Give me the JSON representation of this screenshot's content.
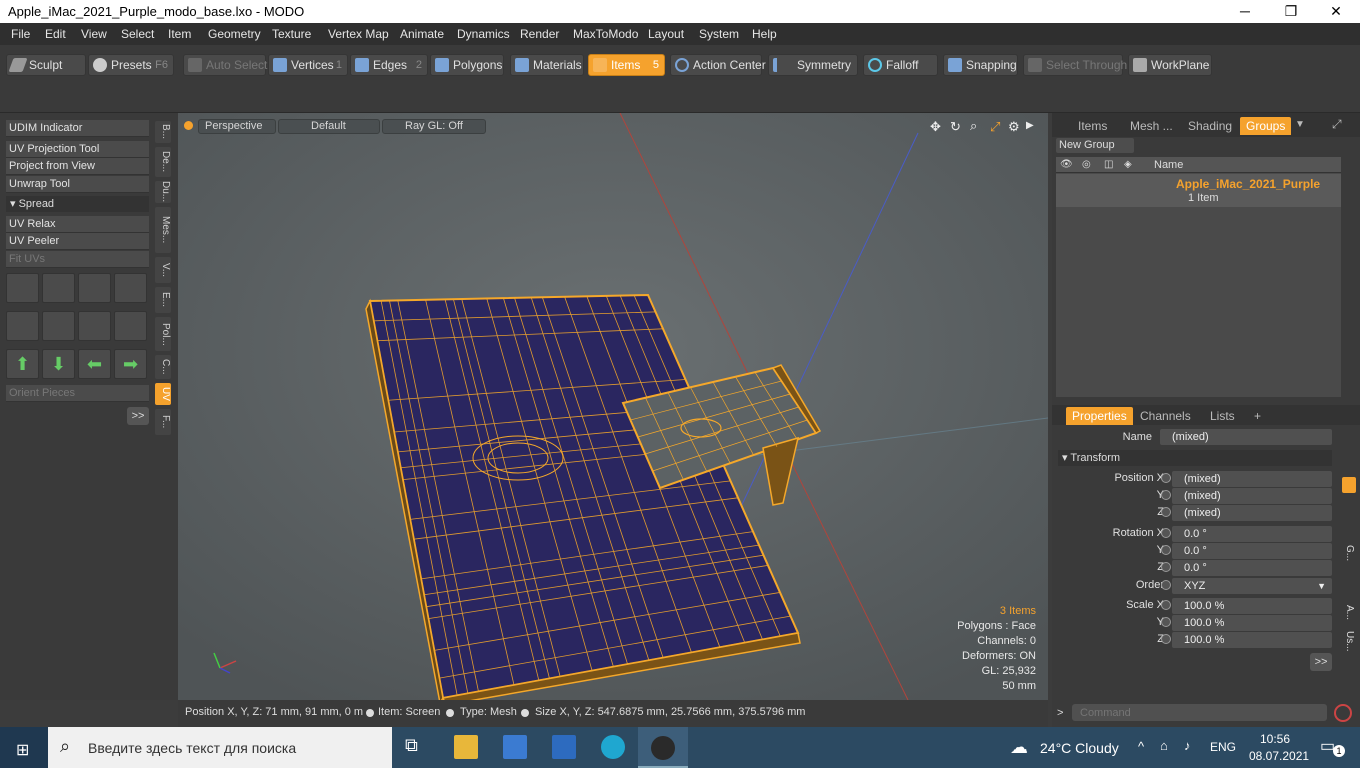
{
  "window": {
    "title": "Apple_iMac_2021_Purple_modo_base.lxo - MODO",
    "minimize": "─",
    "maximize": "❐",
    "close": "✕"
  },
  "menu": [
    "File",
    "Edit",
    "View",
    "Select",
    "Item",
    "Geometry",
    "Texture",
    "Vertex Map",
    "Animate",
    "Dynamics",
    "Render",
    "MaxToModo",
    "Layout",
    "System",
    "Help"
  ],
  "toolbar": {
    "sculpt": "Sculpt",
    "presets": "Presets",
    "presets_key": "F6",
    "auto_select": "Auto Select",
    "vertices": "Vertices",
    "vertices_count": "1",
    "edges": "Edges",
    "edges_count": "2",
    "polygons": "Polygons",
    "materials": "Materials",
    "items": "Items",
    "items_count": "5",
    "action_center": "Action Center",
    "symmetry": "Symmetry",
    "falloff": "Falloff",
    "snapping": "Snapping",
    "select_through": "Select Through",
    "workplane": "WorkPlane"
  },
  "left": {
    "tools": [
      "UDIM Indicator",
      "UV Projection Tool",
      "Project from View",
      "Unwrap Tool"
    ],
    "spread_header": "Spread",
    "tools2": [
      "UV Relax",
      "UV Peeler"
    ],
    "fit_uvs": "Fit UVs",
    "orient_pieces": "Orient Pieces",
    "more": ">>",
    "vtabs": [
      "B...",
      "De...",
      "Du...",
      "Mes...",
      "V...",
      "E...",
      "Pol...",
      "C...",
      "UV",
      "F..."
    ]
  },
  "viewport": {
    "view": "Perspective",
    "shading": "Default",
    "raygl": "Ray GL: Off",
    "info": {
      "items": "3 Items",
      "polygons": "Polygons : Face",
      "channels": "Channels: 0",
      "deformers": "Deformers: ON",
      "gl": "GL: 25,932",
      "scale": "50 mm"
    },
    "accent": "#f5a22d",
    "mesh_color": "#f5a82a",
    "fill_color": "#2a2660"
  },
  "status": {
    "position": "Position X, Y, Z:   71 mm, 91 mm, 0 m",
    "item": "Item:  Screen",
    "type": "Type:  Mesh",
    "size": "Size X, Y, Z:   547.6875 mm, 25.7566 mm, 375.5796 mm"
  },
  "right": {
    "tabs": [
      "Items",
      "Mesh ...",
      "Shading",
      "Groups"
    ],
    "new_group": "New Group",
    "col_name": "Name",
    "group_name": "Apple_iMac_2021_Purple",
    "group_count": "1 Item",
    "prop_tabs": [
      "Properties",
      "Channels",
      "Lists",
      "+"
    ],
    "name_label": "Name",
    "name_value": "(mixed)",
    "transform": "Transform",
    "position_label": "Position X",
    "y": "Y",
    "z": "Z",
    "pos": [
      "(mixed)",
      "(mixed)",
      "(mixed)"
    ],
    "rotation_label": "Rotation X",
    "rot": [
      "0.0 °",
      "0.0 °",
      "0.0 °"
    ],
    "order_label": "Order",
    "order_value": "XYZ",
    "scale_label": "Scale X",
    "scale": [
      "100.0 %",
      "100.0 %",
      "100.0 %"
    ],
    "more": ">>",
    "side_tabs": [
      "G...",
      "A...",
      "Us..."
    ],
    "command_placeholder": "Command",
    "prompt": ">"
  },
  "taskbar": {
    "search": "Введите здесь текст для поиска",
    "weather": "24°C  Cloudy",
    "lang": "ENG",
    "time": "10:56",
    "date": "08.07.2021",
    "notif": "1"
  }
}
